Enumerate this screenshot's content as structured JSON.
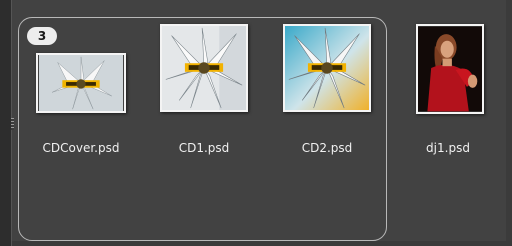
{
  "stack": {
    "count": "3"
  },
  "files": [
    {
      "name": "CDCover.psd",
      "kind": "cd-art-thumbnail"
    },
    {
      "name": "CD1.psd",
      "kind": "cd-art-thumbnail"
    },
    {
      "name": "CD2.psd",
      "kind": "cd-art-thumbnail"
    },
    {
      "name": "dj1.psd",
      "kind": "photo-thumbnail"
    }
  ],
  "colors": {
    "panel_background": "#424242",
    "stack_border": "#b8b8b8",
    "label_text": "#f0f0f0",
    "badge_background": "#ededed"
  }
}
